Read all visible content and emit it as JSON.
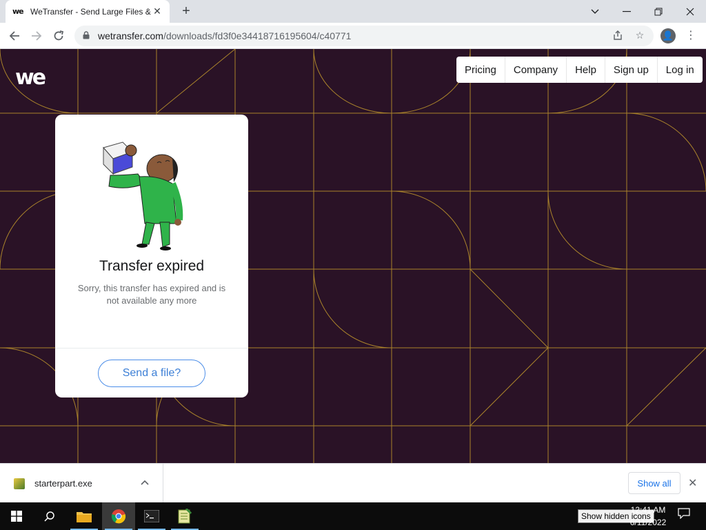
{
  "browser": {
    "tab_title": "WeTransfer - Send Large Files &",
    "tab_favicon": "we",
    "url_domain": "wetransfer.com",
    "url_path": "/downloads/fd3f0e34418716195604/c40771"
  },
  "site": {
    "logo": "we",
    "nav": [
      "Pricing",
      "Company",
      "Help",
      "Sign up",
      "Log in"
    ],
    "background_color": "#2a1226",
    "line_color": "#b8902c"
  },
  "card": {
    "title": "Transfer expired",
    "message": "Sorry, this transfer has expired and is not available any more",
    "button": "Send a file?"
  },
  "download_bar": {
    "file_name": "starterpart.exe",
    "show_all": "Show all"
  },
  "taskbar": {
    "clock_time": "12:41 AM",
    "clock_date": "6/11/2022",
    "tooltip": "Show hidden icons"
  }
}
